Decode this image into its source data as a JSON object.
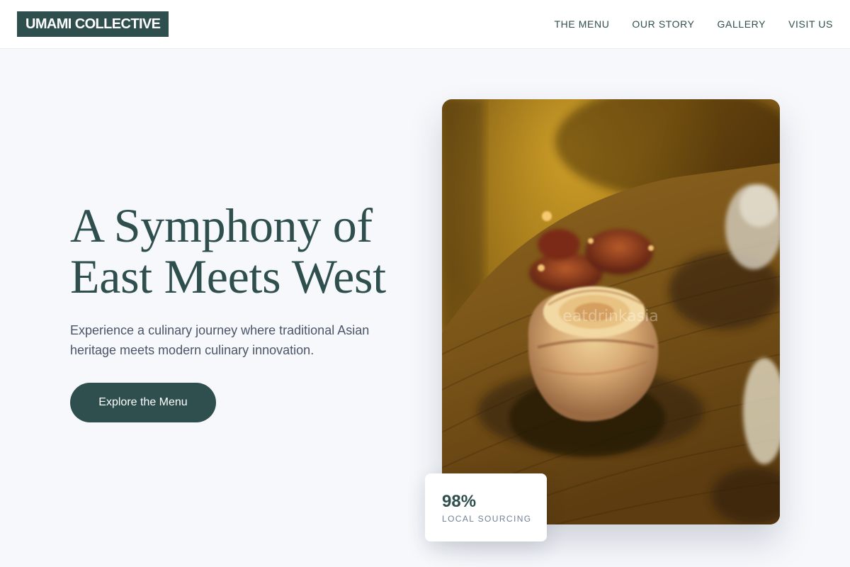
{
  "brand": {
    "logo_text": "UMAMI COLLECTIVE",
    "primary_color": "#2f4f4f",
    "background_color": "#f6f8fc"
  },
  "nav": {
    "items": [
      {
        "label": "THE MENU"
      },
      {
        "label": "OUR STORY"
      },
      {
        "label": "GALLERY"
      },
      {
        "label": "VISIT US"
      }
    ]
  },
  "hero": {
    "title_line1": "A Symphony of",
    "title_line2": "East Meets West",
    "description": "Experience a culinary journey where traditional Asian heritage meets modern culinary innovation.",
    "cta_label": "Explore the Menu",
    "image": {
      "subject": "plated rolled sushi pieces on a wooden board, warm blurred lighting",
      "watermark": "eatdrinkasia"
    }
  },
  "stat": {
    "value": "98%",
    "label": "LOCAL SOURCING"
  }
}
